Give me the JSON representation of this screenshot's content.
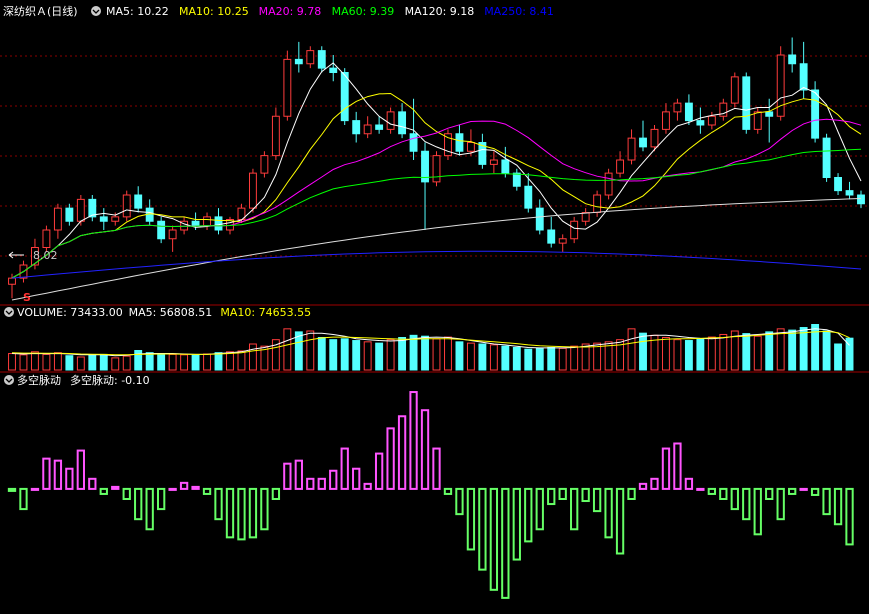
{
  "main_panel": {
    "title": "深纺织Ａ(日线)",
    "ma_labels": [
      {
        "text": "MA5: 10.22",
        "color": "#ffffff"
      },
      {
        "text": "MA10: 10.25",
        "color": "#ffff00"
      },
      {
        "text": "MA20: 9.78",
        "color": "#ff00ff"
      },
      {
        "text": "MA60: 9.39",
        "color": "#00ff00"
      },
      {
        "text": "MA120: 9.18",
        "color": "#ffffff"
      },
      {
        "text": "MA250: 8.41",
        "color": "#0000ff"
      }
    ],
    "low_marker": "8.02",
    "s_marker": "S"
  },
  "volume_panel": {
    "labels": [
      {
        "text": "VOLUME: 73433.00",
        "color": "#ffffff"
      },
      {
        "text": "MA5: 56808.51",
        "color": "#ffffff"
      },
      {
        "text": "MA10: 74653.55",
        "color": "#ffff00"
      }
    ]
  },
  "indicator_panel": {
    "name": "多空脉动",
    "label": "多空脉动: -0.10"
  },
  "colors": {
    "up": "#ff3c3c",
    "down": "#54ffff",
    "grid": "#8b0000",
    "pos_bar": "#ff55ff",
    "neg_bar": "#66ff66"
  },
  "chart_data": {
    "type": "candlestick",
    "price_range": [
      8.0,
      11.2
    ],
    "candles": [
      {
        "o": 8.18,
        "h": 8.3,
        "l": 8.02,
        "c": 8.25
      },
      {
        "o": 8.25,
        "h": 8.45,
        "l": 8.2,
        "c": 8.4
      },
      {
        "o": 8.4,
        "h": 8.7,
        "l": 8.35,
        "c": 8.6
      },
      {
        "o": 8.6,
        "h": 8.85,
        "l": 8.55,
        "c": 8.8
      },
      {
        "o": 8.8,
        "h": 9.1,
        "l": 8.7,
        "c": 9.05
      },
      {
        "o": 9.05,
        "h": 9.1,
        "l": 8.85,
        "c": 8.9
      },
      {
        "o": 8.9,
        "h": 9.2,
        "l": 8.85,
        "c": 9.15
      },
      {
        "o": 9.15,
        "h": 9.2,
        "l": 8.9,
        "c": 8.95
      },
      {
        "o": 8.95,
        "h": 9.05,
        "l": 8.8,
        "c": 8.9
      },
      {
        "o": 8.9,
        "h": 9.0,
        "l": 8.85,
        "c": 8.95
      },
      {
        "o": 8.95,
        "h": 9.25,
        "l": 8.9,
        "c": 9.2
      },
      {
        "o": 9.2,
        "h": 9.3,
        "l": 9.0,
        "c": 9.05
      },
      {
        "o": 9.05,
        "h": 9.15,
        "l": 8.85,
        "c": 8.9
      },
      {
        "o": 8.9,
        "h": 8.95,
        "l": 8.65,
        "c": 8.7
      },
      {
        "o": 8.7,
        "h": 8.85,
        "l": 8.55,
        "c": 8.8
      },
      {
        "o": 8.8,
        "h": 8.95,
        "l": 8.75,
        "c": 8.9
      },
      {
        "o": 8.9,
        "h": 9.0,
        "l": 8.8,
        "c": 8.85
      },
      {
        "o": 8.85,
        "h": 9.0,
        "l": 8.8,
        "c": 8.95
      },
      {
        "o": 8.95,
        "h": 9.05,
        "l": 8.75,
        "c": 8.8
      },
      {
        "o": 8.8,
        "h": 8.95,
        "l": 8.75,
        "c": 8.92
      },
      {
        "o": 8.92,
        "h": 9.1,
        "l": 8.88,
        "c": 9.05
      },
      {
        "o": 9.05,
        "h": 9.5,
        "l": 9.0,
        "c": 9.45
      },
      {
        "o": 9.45,
        "h": 9.7,
        "l": 9.4,
        "c": 9.65
      },
      {
        "o": 9.65,
        "h": 10.2,
        "l": 9.6,
        "c": 10.1
      },
      {
        "o": 10.1,
        "h": 10.85,
        "l": 10.05,
        "c": 10.75
      },
      {
        "o": 10.75,
        "h": 10.95,
        "l": 10.6,
        "c": 10.7
      },
      {
        "o": 10.7,
        "h": 10.9,
        "l": 10.65,
        "c": 10.85
      },
      {
        "o": 10.85,
        "h": 10.9,
        "l": 10.6,
        "c": 10.65
      },
      {
        "o": 10.65,
        "h": 10.8,
        "l": 10.5,
        "c": 10.6
      },
      {
        "o": 10.6,
        "h": 10.65,
        "l": 10.0,
        "c": 10.05
      },
      {
        "o": 10.05,
        "h": 10.15,
        "l": 9.8,
        "c": 9.9
      },
      {
        "o": 9.9,
        "h": 10.1,
        "l": 9.85,
        "c": 10.0
      },
      {
        "o": 10.0,
        "h": 10.1,
        "l": 9.9,
        "c": 9.95
      },
      {
        "o": 9.95,
        "h": 10.2,
        "l": 9.9,
        "c": 10.15
      },
      {
        "o": 10.15,
        "h": 10.25,
        "l": 9.85,
        "c": 9.9
      },
      {
        "o": 9.9,
        "h": 10.3,
        "l": 9.6,
        "c": 9.7
      },
      {
        "o": 9.7,
        "h": 9.8,
        "l": 8.8,
        "c": 9.35
      },
      {
        "o": 9.35,
        "h": 9.7,
        "l": 9.3,
        "c": 9.65
      },
      {
        "o": 9.65,
        "h": 9.95,
        "l": 9.6,
        "c": 9.9
      },
      {
        "o": 9.9,
        "h": 10.0,
        "l": 9.65,
        "c": 9.7
      },
      {
        "o": 9.7,
        "h": 9.95,
        "l": 9.65,
        "c": 9.8
      },
      {
        "o": 9.8,
        "h": 9.9,
        "l": 9.5,
        "c": 9.55
      },
      {
        "o": 9.55,
        "h": 9.7,
        "l": 9.45,
        "c": 9.6
      },
      {
        "o": 9.6,
        "h": 9.75,
        "l": 9.4,
        "c": 9.45
      },
      {
        "o": 9.45,
        "h": 9.5,
        "l": 9.25,
        "c": 9.3
      },
      {
        "o": 9.3,
        "h": 9.45,
        "l": 9.0,
        "c": 9.05
      },
      {
        "o": 9.05,
        "h": 9.15,
        "l": 8.75,
        "c": 8.8
      },
      {
        "o": 8.8,
        "h": 8.95,
        "l": 8.6,
        "c": 8.65
      },
      {
        "o": 8.65,
        "h": 8.75,
        "l": 8.55,
        "c": 8.7
      },
      {
        "o": 8.7,
        "h": 8.95,
        "l": 8.65,
        "c": 8.9
      },
      {
        "o": 8.9,
        "h": 9.05,
        "l": 8.85,
        "c": 9.0
      },
      {
        "o": 9.0,
        "h": 9.25,
        "l": 8.95,
        "c": 9.2
      },
      {
        "o": 9.2,
        "h": 9.5,
        "l": 9.15,
        "c": 9.45
      },
      {
        "o": 9.45,
        "h": 9.7,
        "l": 9.4,
        "c": 9.6
      },
      {
        "o": 9.6,
        "h": 9.95,
        "l": 9.55,
        "c": 9.85
      },
      {
        "o": 9.85,
        "h": 10.05,
        "l": 9.7,
        "c": 9.75
      },
      {
        "o": 9.75,
        "h": 10.0,
        "l": 9.7,
        "c": 9.95
      },
      {
        "o": 9.95,
        "h": 10.25,
        "l": 9.9,
        "c": 10.15
      },
      {
        "o": 10.15,
        "h": 10.3,
        "l": 10.05,
        "c": 10.25
      },
      {
        "o": 10.25,
        "h": 10.35,
        "l": 10.0,
        "c": 10.05
      },
      {
        "o": 10.05,
        "h": 10.2,
        "l": 9.9,
        "c": 10.0
      },
      {
        "o": 10.0,
        "h": 10.15,
        "l": 9.95,
        "c": 10.1
      },
      {
        "o": 10.1,
        "h": 10.3,
        "l": 10.05,
        "c": 10.25
      },
      {
        "o": 10.25,
        "h": 10.6,
        "l": 10.2,
        "c": 10.55
      },
      {
        "o": 10.55,
        "h": 10.6,
        "l": 9.9,
        "c": 9.95
      },
      {
        "o": 9.95,
        "h": 10.2,
        "l": 9.9,
        "c": 10.15
      },
      {
        "o": 10.15,
        "h": 10.3,
        "l": 9.8,
        "c": 10.1
      },
      {
        "o": 10.1,
        "h": 10.9,
        "l": 10.05,
        "c": 10.8
      },
      {
        "o": 10.8,
        "h": 11.0,
        "l": 10.6,
        "c": 10.7
      },
      {
        "o": 10.7,
        "h": 10.95,
        "l": 10.3,
        "c": 10.4
      },
      {
        "o": 10.4,
        "h": 10.5,
        "l": 9.8,
        "c": 9.85
      },
      {
        "o": 9.85,
        "h": 9.9,
        "l": 9.35,
        "c": 9.4
      },
      {
        "o": 9.4,
        "h": 9.45,
        "l": 9.2,
        "c": 9.25
      },
      {
        "o": 9.25,
        "h": 9.35,
        "l": 9.15,
        "c": 9.2
      },
      {
        "o": 9.2,
        "h": 9.25,
        "l": 9.05,
        "c": 9.1
      }
    ],
    "volume": {
      "max": 120000,
      "values": [
        38000,
        35000,
        42000,
        36000,
        40000,
        33000,
        30000,
        34000,
        36000,
        28000,
        32000,
        45000,
        40000,
        38000,
        36000,
        35000,
        34000,
        37000,
        40000,
        42000,
        44000,
        60000,
        55000,
        70000,
        95000,
        88000,
        90000,
        75000,
        70000,
        72000,
        68000,
        65000,
        62000,
        70000,
        75000,
        80000,
        78000,
        72000,
        76000,
        65000,
        62000,
        60000,
        58000,
        55000,
        52000,
        48000,
        50000,
        52000,
        50000,
        55000,
        60000,
        62000,
        65000,
        70000,
        95000,
        85000,
        80000,
        75000,
        70000,
        68000,
        72000,
        76000,
        82000,
        90000,
        84000,
        78000,
        88000,
        95000,
        92000,
        98000,
        105000,
        90000,
        60000,
        73433
      ],
      "ma5": [
        38000,
        37000,
        38000,
        37500,
        38000,
        37000,
        35000,
        35000,
        35000,
        33000,
        34000,
        37000,
        38000,
        38000,
        38000,
        37000,
        36000,
        36000,
        38000,
        40000,
        42000,
        48000,
        52000,
        58000,
        68000,
        78000,
        85000,
        85000,
        82000,
        78000,
        72000,
        70000,
        68000,
        67000,
        68000,
        72000,
        75000,
        76000,
        75000,
        72000,
        68000,
        64000,
        60000,
        58000,
        55000,
        52000,
        51000,
        51000,
        51000,
        52000,
        55000,
        58000,
        61000,
        64000,
        72000,
        78000,
        80000,
        80000,
        78000,
        75000,
        73000,
        72000,
        74000,
        78000,
        80000,
        82000,
        84000,
        86000,
        88000,
        92000,
        95000,
        93000,
        85000,
        56808
      ],
      "ma10": [
        40000,
        39000,
        39000,
        38500,
        38500,
        38000,
        37000,
        36500,
        36000,
        35000,
        35000,
        36000,
        36500,
        37000,
        37000,
        36500,
        36000,
        36000,
        37000,
        38000,
        40000,
        44000,
        47000,
        52000,
        58000,
        64000,
        70000,
        74000,
        76000,
        76000,
        75000,
        74000,
        73000,
        72000,
        71000,
        71000,
        72000,
        72000,
        72000,
        71000,
        69000,
        67000,
        65000,
        63000,
        61000,
        58000,
        56000,
        55000,
        54000,
        53000,
        53000,
        54000,
        56000,
        58000,
        62000,
        66000,
        69000,
        71000,
        72000,
        72000,
        73000,
        74000,
        75000,
        77000,
        78000,
        80000,
        82000,
        84000,
        85000,
        86000,
        88000,
        89000,
        86000,
        74653
      ]
    },
    "oscillator": {
      "range": [
        -1.2,
        1.0
      ],
      "values": [
        -0.02,
        -0.2,
        0.0,
        0.3,
        0.28,
        0.2,
        0.38,
        0.1,
        -0.05,
        0.02,
        -0.1,
        -0.3,
        -0.4,
        -0.2,
        0.0,
        0.06,
        0.02,
        -0.05,
        -0.3,
        -0.48,
        -0.5,
        -0.48,
        -0.4,
        -0.1,
        0.25,
        0.28,
        0.1,
        0.1,
        0.18,
        0.4,
        0.2,
        0.05,
        0.35,
        0.6,
        0.72,
        0.96,
        0.78,
        0.4,
        -0.05,
        -0.25,
        -0.6,
        -0.8,
        -1.0,
        -1.08,
        -0.7,
        -0.52,
        -0.4,
        -0.15,
        -0.1,
        -0.4,
        -0.12,
        -0.22,
        -0.48,
        -0.64,
        -0.1,
        0.05,
        0.1,
        0.4,
        0.45,
        0.1,
        0.0,
        -0.05,
        -0.1,
        -0.2,
        -0.3,
        -0.45,
        -0.1,
        -0.3,
        -0.05,
        0.0,
        -0.06,
        -0.25,
        -0.35,
        -0.55
      ]
    }
  }
}
